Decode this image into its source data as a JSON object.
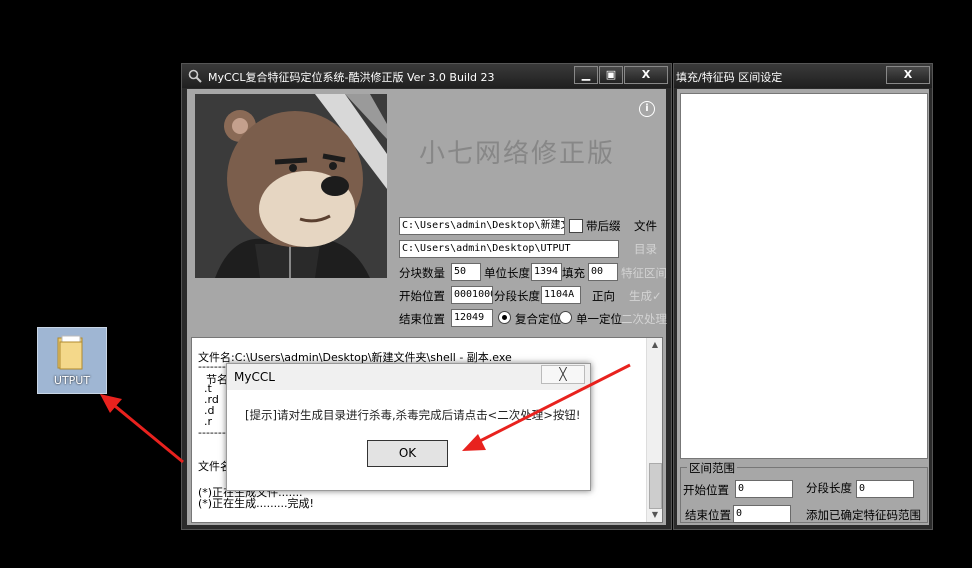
{
  "desktop": {
    "folder_label": "UTPUT"
  },
  "main_window": {
    "title": "MyCCL复合特征码定位系统-酷洪修正版  Ver 3.0  Build 23",
    "banner": "小七网络修正版",
    "info_icon": "i",
    "file_path": "C:\\Users\\admin\\Desktop\\新建文",
    "with_suffix_label": "带后缀",
    "file_button": "文件",
    "dir_path": "C:\\Users\\admin\\Desktop\\UTPUT",
    "dir_button": "目录",
    "block_count_label": "分块数量",
    "block_count_value": "50",
    "unit_length_label": "单位长度",
    "unit_length_value": "1394",
    "fill_label": "填充",
    "fill_value": "00",
    "feature_range_label": "特征区间",
    "start_pos_label": "开始位置",
    "start_pos_value": "0001000",
    "segment_length_label": "分段长度",
    "segment_length_value": "1104A",
    "forward_label": "正向",
    "generate_label": "生成✓",
    "end_pos_label": "结束位置",
    "end_pos_value": "12049",
    "composite_label": "复合定位",
    "single_label": "单一定位",
    "secondary_label": "二次处理",
    "log_lines": [
      "文件名:C:\\Users\\admin\\Desktop\\新建文件夹\\shell - 副本.exe",
      "-------",
      "节名",
      " .t",
      ".rd",
      " .d",
      " .r",
      "-------",
      "文件名",
      "(*)正在生成文件.......",
      "(*)正在生成.........完成!"
    ]
  },
  "side_window": {
    "title": "填充/特征码 区间设定",
    "group_title": "区间范围",
    "start_pos_label": "开始位置",
    "start_pos_value": "0",
    "segment_length_label": "分段长度",
    "segment_length_value": "0",
    "end_pos_label": "结束位置",
    "end_pos_value": "0",
    "add_range_label": "添加已确定特征码范围"
  },
  "dialog": {
    "title": "MyCCL",
    "close_glyph": "╳",
    "message": "[提示]请对生成目录进行杀毒,杀毒完成后请点击<二次处理>按钮!",
    "ok_label": "OK"
  },
  "window_controls": {
    "minimize": "▁",
    "maximize": "▣",
    "close": "X"
  },
  "colors": {
    "arrow": "#e8221e",
    "window_bg": "#a7a7a7",
    "banner_text": "#878787"
  }
}
